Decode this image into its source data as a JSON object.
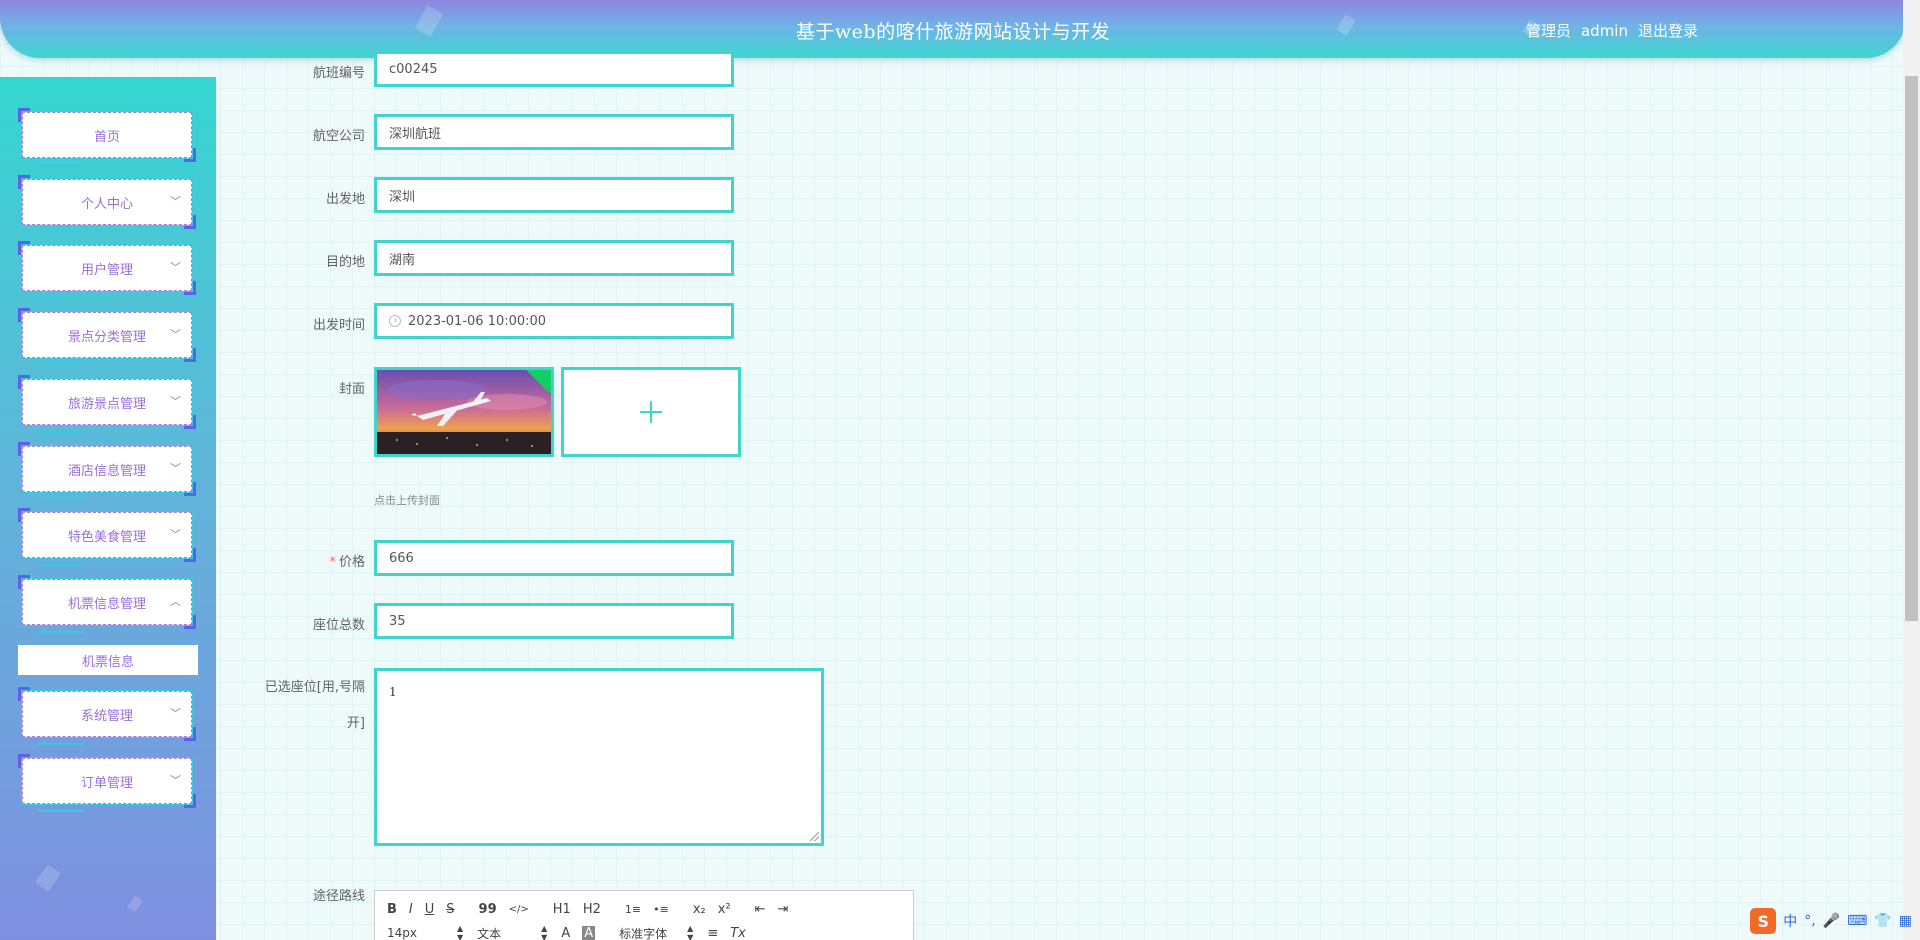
{
  "header": {
    "title": "基于web的喀什旅游网站设计与开发",
    "role": "管理员",
    "username": "admin",
    "logout": "退出登录"
  },
  "sidebar": {
    "items": [
      {
        "label": "首页",
        "chevron": ""
      },
      {
        "label": "个人中心",
        "chevron": "﹀"
      },
      {
        "label": "用户管理",
        "chevron": "﹀"
      },
      {
        "label": "景点分类管理",
        "chevron": "﹀"
      },
      {
        "label": "旅游景点管理",
        "chevron": "﹀"
      },
      {
        "label": "酒店信息管理",
        "chevron": "﹀"
      },
      {
        "label": "特色美食管理",
        "chevron": "﹀"
      },
      {
        "label": "机票信息管理",
        "chevron": "︿"
      },
      {
        "label": "系统管理",
        "chevron": "﹀"
      },
      {
        "label": "订单管理",
        "chevron": "﹀"
      }
    ],
    "submenu": "机票信息"
  },
  "form": {
    "flight_no": {
      "label": "航班编号",
      "value": "c00245"
    },
    "airline": {
      "label": "航空公司",
      "value": "深圳航班"
    },
    "origin": {
      "label": "出发地",
      "value": "深圳"
    },
    "destination": {
      "label": "目的地",
      "value": "湖南"
    },
    "depart_time": {
      "label": "出发时间",
      "value": "2023-01-06 10:00:00",
      "icon": "clock-icon"
    },
    "cover": {
      "label": "封面",
      "tip": "点击上传封面",
      "upload_icon": "plus-icon"
    },
    "price": {
      "required": "*",
      "label": "价格",
      "value": "666"
    },
    "seats_total": {
      "label": "座位总数",
      "value": "35"
    },
    "seats_selected": {
      "label_line1": "已选座位[用,号隔",
      "label_line2": "开]",
      "value": "1"
    },
    "route": {
      "label": "途径路线"
    }
  },
  "editor": {
    "toolbar_row1": [
      "B",
      "I",
      "U",
      "S",
      "99",
      "</>",
      "H1",
      "H2",
      "1≡",
      "•≡",
      "x₂",
      "x²",
      "⇤",
      "⇥"
    ],
    "toolbar_row2": {
      "size": "14px",
      "format": "文本",
      "color": "A",
      "bg": "A",
      "font": "标准字体",
      "align": "≡",
      "clear": "Tx"
    }
  },
  "ime": {
    "logo": "S",
    "lang": "中",
    "punct": "°,"
  },
  "colors": {
    "accent": "#40d5cc",
    "menu_text": "#9a6fd8",
    "required": "#f56c6c"
  }
}
